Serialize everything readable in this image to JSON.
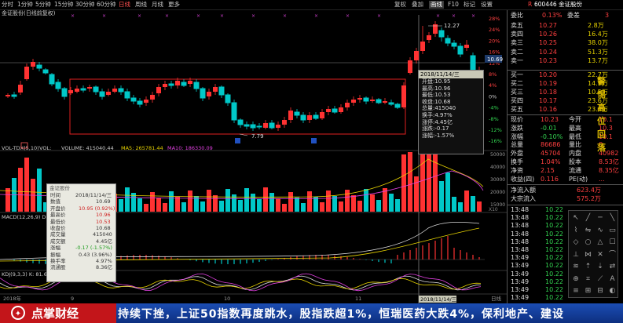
{
  "toolbar": {
    "periods": [
      "分时",
      "1分钟",
      "5分钟",
      "15分钟",
      "30分钟",
      "60分钟",
      "日线",
      "周线",
      "月线",
      "更多"
    ],
    "active_period": "日线",
    "right_buttons": [
      "复权",
      "叠加",
      "画线",
      "F10",
      "标记",
      "设置"
    ],
    "active_right": "画线",
    "stock_code": "600446",
    "stock_name": "金证股份"
  },
  "chart_title": "金证股份(日线前复权)",
  "price_axis": [
    "28%",
    "24%",
    "20%",
    "16%",
    "12%",
    "8%",
    "4%",
    "0%",
    "-4%",
    "-8%",
    "-12%",
    "-16%"
  ],
  "current_price_tag": "10.69",
  "high_label": "12.27",
  "low_label": "7.79",
  "volume_header": {
    "name": "VOL-TDX(5,10)",
    "vol_label": "VOL:",
    "volume": "VOLUME: 415040.44",
    "ma5": "MA5: 265781.44",
    "ma10": "MA10: 186330.09"
  },
  "volume_axis": [
    "50000",
    "40000",
    "30000",
    "20000",
    "15000"
  ],
  "volume_unit": "X10",
  "macd_header": "MACD(12,26,9) DIF: ... DEA: ... MACD: 0.42",
  "kdj_header": "KDJ(9,3,3) K: 81.68",
  "x_dates": [
    "2018年",
    "9",
    "10",
    "11",
    "2018/11/14/三",
    "日线"
  ],
  "popup1": {
    "title": "2018/11/14/三",
    "rows": [
      "开盘:10.95",
      "最高:10.96",
      "最低:10.53",
      "收盘:10.68",
      "总量:415040",
      "换手:4.97%",
      "涨停:4.45亿",
      "涨跌:-0.17",
      "涨幅:-1.57%"
    ]
  },
  "popup2": {
    "title": "金证股份",
    "rows": [
      {
        "k": "时间",
        "v": "2018/11/14/三"
      },
      {
        "k": "数值",
        "v": "10.69"
      },
      {
        "k": "开盘价",
        "v": "10.95 (0.92%)"
      },
      {
        "k": "最高价",
        "v": "10.96"
      },
      {
        "k": "最低价",
        "v": "10.53"
      },
      {
        "k": "收盘价",
        "v": "10.68"
      },
      {
        "k": "成交量",
        "v": "415040"
      },
      {
        "k": "成交额",
        "v": "4.45亿"
      },
      {
        "k": "涨幅",
        "v": "-0.17 (-1.57%)"
      },
      {
        "k": "振幅",
        "v": "0.43 (3.96%)"
      },
      {
        "k": "换手率",
        "v": "4.97%"
      },
      {
        "k": "流通股",
        "v": "8.36亿"
      }
    ]
  },
  "quote": {
    "webi": {
      "label": "委比",
      "value": "0.13%",
      "label2": "委差",
      "value2": "3"
    },
    "sells": [
      {
        "label": "卖五",
        "price": "10.27",
        "vol": "2.8万"
      },
      {
        "label": "卖四",
        "price": "10.26",
        "vol": "16.4万"
      },
      {
        "label": "卖三",
        "price": "10.25",
        "vol": "38.0万"
      },
      {
        "label": "卖二",
        "price": "10.24",
        "vol": "51.3万"
      },
      {
        "label": "卖一",
        "price": "10.23",
        "vol": "13.7万"
      }
    ],
    "buys": [
      {
        "label": "买一",
        "price": "10.20",
        "vol": "22.7万"
      },
      {
        "label": "买二",
        "price": "10.19",
        "vol": "14.9万"
      },
      {
        "label": "买三",
        "price": "10.18",
        "vol": "10.5万"
      },
      {
        "label": "买四",
        "price": "10.17",
        "vol": "23.6万"
      },
      {
        "label": "买五",
        "price": "10.16",
        "vol": "23.4万"
      }
    ],
    "stats": [
      {
        "l1": "现价",
        "v1": "10.23",
        "l2": "今开",
        "v2": "10.1"
      },
      {
        "l1": "涨跌",
        "v1": "-0.01",
        "l2": "最高",
        "v2": "10.3"
      },
      {
        "l1": "涨幅",
        "v1": "-0.10%",
        "l2": "最低",
        "v2": "10.1"
      },
      {
        "l1": "总量",
        "v1": "86686",
        "l2": "量比",
        "v2": "0."
      },
      {
        "l1": "外盘",
        "v1": "45704",
        "l2": "内盘",
        "v2": "40982"
      },
      {
        "l1": "换手",
        "v1": "1.04%",
        "l2": "股本",
        "v2": "8.53亿"
      },
      {
        "l1": "净资",
        "v1": "2.15",
        "l2": "流通",
        "v2": "8.35亿"
      },
      {
        "l1": "收益(四)",
        "v1": "0.116",
        "l2": "PE(动)",
        "v2": "..."
      }
    ],
    "flow": [
      {
        "label": "净流入额",
        "value": "623.4万"
      },
      {
        "label": "大宗流入",
        "value": "575.2万"
      }
    ],
    "ticks": [
      {
        "time": "13:48",
        "price": "10.22"
      },
      {
        "time": "13:48",
        "price": "10.22"
      },
      {
        "time": "13:48",
        "price": "10.22"
      },
      {
        "time": "13:48",
        "price": "10.22"
      },
      {
        "time": "13:48",
        "price": "10.22"
      },
      {
        "time": "13:48",
        "price": "10.22"
      },
      {
        "time": "13:49",
        "price": "10.22"
      },
      {
        "time": "13:49",
        "price": "10.22"
      },
      {
        "time": "13:49",
        "price": "10.22"
      },
      {
        "time": "13:49",
        "price": "10.22"
      },
      {
        "time": "13:49",
        "price": "10.22"
      },
      {
        "time": "13:49",
        "price": "10.22"
      }
    ]
  },
  "vertical_text": [
    "警",
    "惕",
    "高",
    "位",
    "回",
    "落"
  ],
  "ticker": {
    "logo": "点掌财经",
    "text": "持续下挫，上证50指数再度跳水，股指跌超1%，恒瑞医药大跌4%，保利地产、建设"
  },
  "colors": {
    "up": "#ff3232",
    "down": "#00c8c8",
    "green": "#32d250",
    "yellow": "#e6d200",
    "bg": "#000000",
    "rect": "#e02020"
  }
}
